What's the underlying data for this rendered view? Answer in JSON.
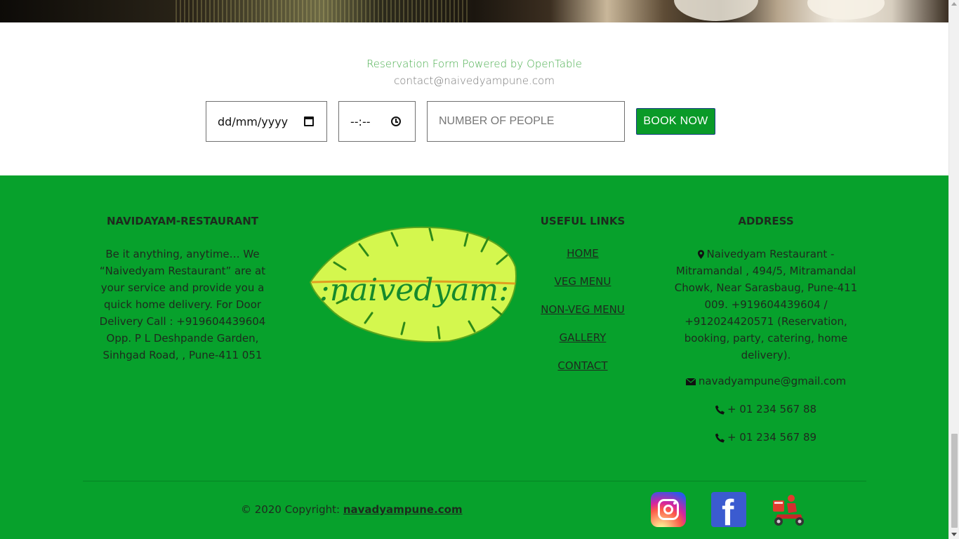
{
  "reservation": {
    "powered_by": "Reservation Form Powered by OpenTable",
    "contact_email": "contact@naivedyampune.com",
    "date_value": "dd/mm/yyyy",
    "time_value": "--:--",
    "people_placeholder": "NUMBER OF PEOPLE",
    "book_label": "BOOK NOW"
  },
  "footer": {
    "about": {
      "title": "NAVIDAYAM-RESTAURANT",
      "text": "Be it anything, anytime… We “Naivedyam Restaurant” are at your service and provide you a quick home delivery. For Door Delivery Call : +919604439604 Opp. P L Deshpande Garden, Sinhgad Road, , Pune-411 051"
    },
    "logo_text": ":naivedyam:",
    "links": {
      "title": "USEFUL LINKS",
      "items": [
        "HOME",
        "VEG MENU",
        "NON-VEG MENU",
        "GALLERY",
        "CONTACT"
      ]
    },
    "address": {
      "title": "ADDRESS",
      "text": "Naivedyam Restaurant - Mitramandal , 494/5, Mitramandal Chowk, Near Sarasbaug, Pune-411 009. +919604439604 / +912024420571 (Reservation, booking, party, catering, home delivery).",
      "email": "navadyampune@gmail.com",
      "phone1": "+ 01 234 567 88",
      "phone2": "+ 01 234 567 89"
    },
    "copyright_prefix": "© 2020 Copyright:",
    "copyright_link": "navadyampune.com"
  },
  "colors": {
    "footer_bg": "#07a12c",
    "button_bg": "#0a9a28",
    "powered_text": "#4caf50",
    "leaf": "#d4f74e"
  },
  "icons": [
    "location-pin-icon",
    "mail-icon",
    "phone-icon",
    "instagram-icon",
    "facebook-icon",
    "delivery-scooter-icon",
    "calendar-icon",
    "clock-icon"
  ]
}
